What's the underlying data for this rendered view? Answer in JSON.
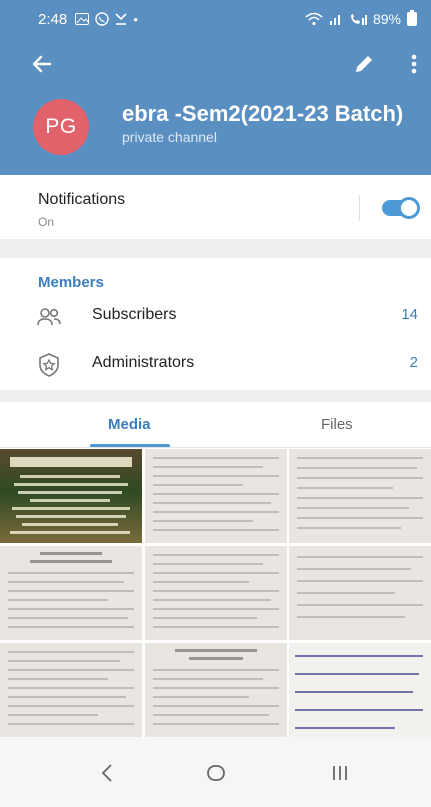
{
  "status_bar": {
    "time": "2:48",
    "battery": "89%",
    "left_icons": [
      "gallery-icon",
      "whatsapp-icon",
      "download-icon"
    ],
    "right_icons": [
      "wifi-icon",
      "signal-icon",
      "call-signal-icon",
      "battery-icon"
    ]
  },
  "toolbar": {
    "back_icon": "arrow-left-icon",
    "edit_icon": "pencil-icon",
    "more_icon": "more-vert-icon"
  },
  "channel": {
    "avatar_initials": "PG",
    "title": "ebra -Sem2(2021-23 Batch)",
    "subtitle": "private channel"
  },
  "notifications": {
    "label": "Notifications",
    "state": "On",
    "enabled": true
  },
  "members": {
    "section_title": "Members",
    "rows": [
      {
        "label": "Subscribers",
        "count": "14",
        "icon": "people-icon"
      },
      {
        "label": "Administrators",
        "count": "2",
        "icon": "admin-shield-icon"
      }
    ]
  },
  "tabs": {
    "media": "Media",
    "files": "Files",
    "active": "Media"
  },
  "media_grid": {
    "rows": 3,
    "columns": 3,
    "visible_thumbnails": 9
  },
  "nav_bar": {
    "back_icon": "chevron-left-icon",
    "home_icon": "home-circle-icon",
    "recents_icon": "recents-icon"
  },
  "colors": {
    "header": "#5a8fc2",
    "accent": "#3a7fc0",
    "avatar": "#e2626c",
    "toggle": "#4d99d6"
  }
}
